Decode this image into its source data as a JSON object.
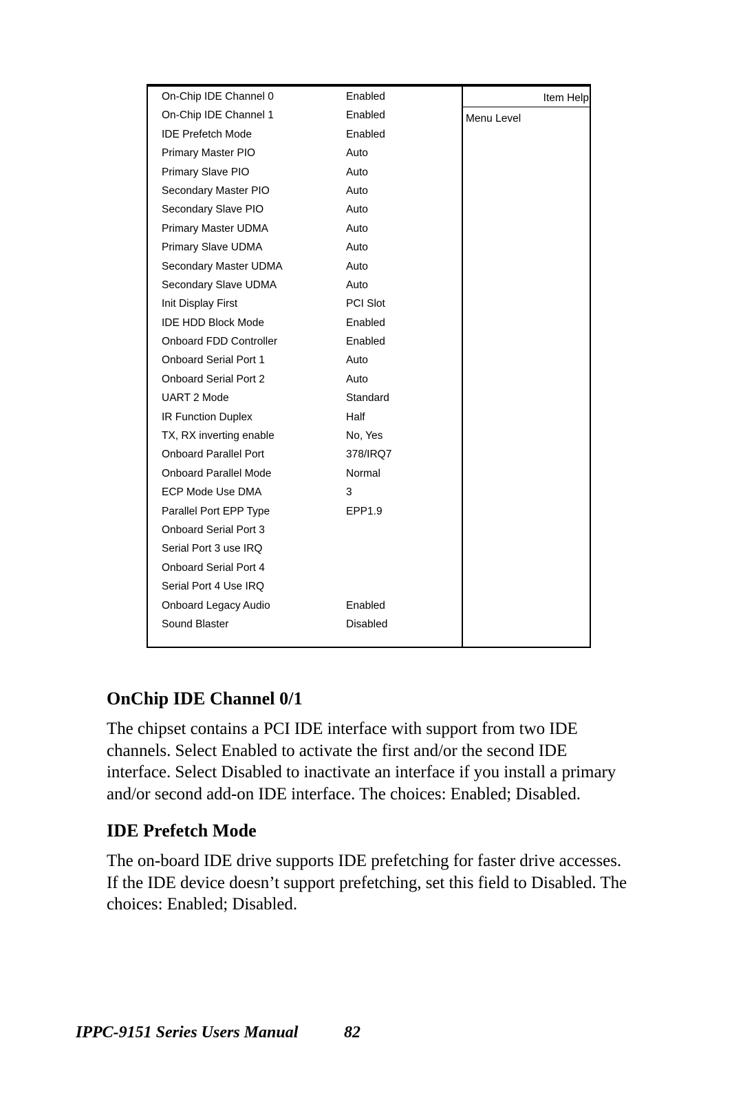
{
  "bios_screen": {
    "help_panel": {
      "title": "Item Help",
      "menu_level_label": "Menu Level"
    },
    "rows": [
      {
        "label": "On-Chip IDE Channel 0",
        "value": "Enabled"
      },
      {
        "label": "On-Chip IDE Channel 1",
        "value": "Enabled"
      },
      {
        "label": "IDE Prefetch Mode",
        "value": "Enabled"
      },
      {
        "label": "Primary Master PIO",
        "value": "Auto"
      },
      {
        "label": "Primary Slave PIO",
        "value": "Auto"
      },
      {
        "label": "Secondary Master PIO",
        "value": "Auto"
      },
      {
        "label": "Secondary Slave PIO",
        "value": "Auto"
      },
      {
        "label": "Primary Master UDMA",
        "value": "Auto"
      },
      {
        "label": "Primary Slave UDMA",
        "value": "Auto"
      },
      {
        "label": "Secondary Master UDMA",
        "value": "Auto"
      },
      {
        "label": "Secondary Slave UDMA",
        "value": "Auto"
      },
      {
        "label": "Init Display First",
        "value": "PCI Slot"
      },
      {
        "label": "IDE HDD Block Mode",
        "value": "Enabled"
      },
      {
        "label": "Onboard FDD Controller",
        "value": "Enabled"
      },
      {
        "label": "Onboard Serial Port 1",
        "value": "Auto"
      },
      {
        "label": "Onboard Serial Port 2",
        "value": "Auto"
      },
      {
        "label": "UART 2 Mode",
        "value": "Standard"
      },
      {
        "label": "IR Function Duplex",
        "value": "Half"
      },
      {
        "label": "TX, RX inverting enable",
        "value": "No, Yes"
      },
      {
        "label": "Onboard Parallel Port",
        "value": "378/IRQ7"
      },
      {
        "label": "Onboard Parallel Mode",
        "value": "Normal"
      },
      {
        "label": "ECP Mode Use DMA",
        "value": "3"
      },
      {
        "label": "Parallel Port EPP Type",
        "value": "EPP1.9"
      },
      {
        "label": "Onboard Serial Port 3",
        "value": ""
      },
      {
        "label": "Serial Port 3 use IRQ",
        "value": ""
      },
      {
        "label": "Onboard Serial Port 4",
        "value": ""
      },
      {
        "label": "Serial Port 4 Use IRQ",
        "value": ""
      },
      {
        "label": "Onboard Legacy Audio",
        "value": "Enabled"
      },
      {
        "label": "Sound Blaster",
        "value": "Disabled"
      }
    ]
  },
  "sections": [
    {
      "heading": "OnChip IDE Channel 0/1",
      "body": "The chipset contains a PCI IDE interface with support from two IDE channels. Select Enabled to activate the first and/or the second IDE interface. Select Disabled to inactivate an interface if you install a primary and/or second add-on IDE interface. The choices: Enabled; Disabled."
    },
    {
      "heading": "IDE Prefetch Mode",
      "body": "The on-board IDE drive supports IDE prefetching for faster drive accesses. If the IDE device doesn’t support prefetching, set this field to Disabled. The choices: Enabled; Disabled."
    }
  ],
  "footer": {
    "manual_title": "IPPC-9151 Series Users Manual",
    "page_number": "82"
  }
}
